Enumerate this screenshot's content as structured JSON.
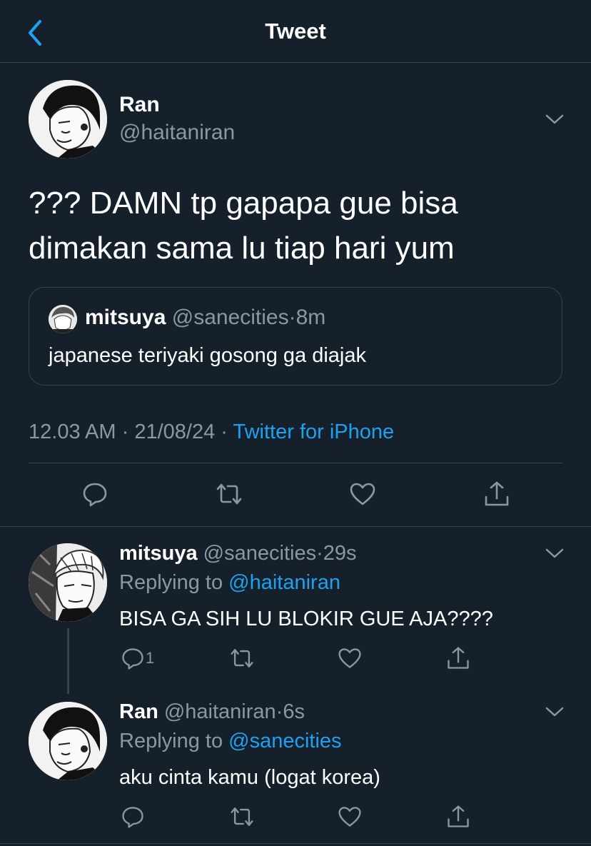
{
  "header": {
    "title": "Tweet",
    "back_icon": "chevron-left-icon"
  },
  "main_tweet": {
    "author_name": "Ran",
    "author_handle": "@haitaniran",
    "text_line1": "??? DAMN tp gapapa gue bisa",
    "text_line2": "dimakan sama lu tiap hari yum",
    "quoted": {
      "author_name": "mitsuya",
      "author_handle": "@sanecities",
      "separator": "·",
      "time": "8m",
      "text": "japanese teriyaki gosong ga diajak"
    },
    "time": "12.03 AM",
    "separator1": "·",
    "date": "21/08/24",
    "separator2": "·",
    "source": "Twitter for iPhone"
  },
  "replies": [
    {
      "author_name": "mitsuya",
      "author_handle": "@sanecities",
      "separator": "·",
      "time": "29s",
      "replying_prefix": "Replying to",
      "replying_to": "@haitaniran",
      "text": "BISA GA SIH LU BLOKIR GUE AJA????",
      "reply_count": "1"
    },
    {
      "author_name": "Ran",
      "author_handle": "@haitaniran",
      "separator": "·",
      "time": "6s",
      "replying_prefix": "Replying to",
      "replying_to": "@sanecities",
      "text": "aku cinta kamu (logat korea)",
      "reply_count": ""
    }
  ],
  "icons": {
    "reply": "reply-icon",
    "retweet": "retweet-icon",
    "like": "heart-icon",
    "share": "share-icon",
    "more": "chevron-down-icon"
  },
  "colors": {
    "background": "#15202b",
    "divider": "#38444d",
    "muted_text": "#8899a6",
    "accent": "#1da1f2",
    "text": "#ffffff"
  }
}
